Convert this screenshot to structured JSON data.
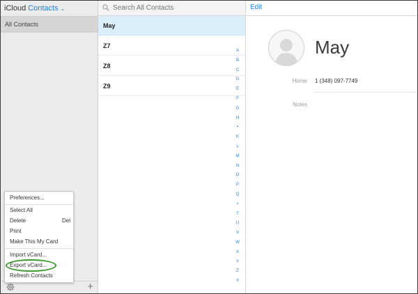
{
  "header": {
    "app_name": "iCloud",
    "section": "Contacts"
  },
  "sidebar": {
    "groups": [
      {
        "label": "All Contacts"
      }
    ]
  },
  "menu": {
    "items": [
      {
        "label": "Preferences..."
      },
      {
        "label": "Select All"
      },
      {
        "label": "Delete",
        "shortcut": "Del"
      },
      {
        "label": "Print"
      },
      {
        "label": "Make This My Card"
      },
      {
        "label": "Import vCard..."
      },
      {
        "label": "Export vCard..."
      },
      {
        "label": "Refresh Contacts"
      }
    ]
  },
  "search": {
    "placeholder": "Search All Contacts"
  },
  "contacts": [
    {
      "name": "May"
    },
    {
      "name": "Z7"
    },
    {
      "name": "Z8"
    },
    {
      "name": "Z9"
    }
  ],
  "index_letters": [
    "A",
    "B",
    "C",
    "D",
    "E",
    "F",
    "G",
    "H",
    "•",
    "K",
    "L",
    "M",
    "N",
    "O",
    "P",
    "Q",
    "•",
    "T",
    "U",
    "V",
    "W",
    "X",
    "Y",
    "Z",
    "#"
  ],
  "detail": {
    "edit_label": "Edit",
    "name": "May",
    "fields": [
      {
        "label": "Home",
        "value": "1 (348) 097-7749"
      },
      {
        "label": "Notes",
        "value": ""
      }
    ]
  },
  "colors": {
    "accent": "#1f7fe0",
    "selected_row": "#dceffc",
    "highlight_oval": "#3a9a2a"
  }
}
